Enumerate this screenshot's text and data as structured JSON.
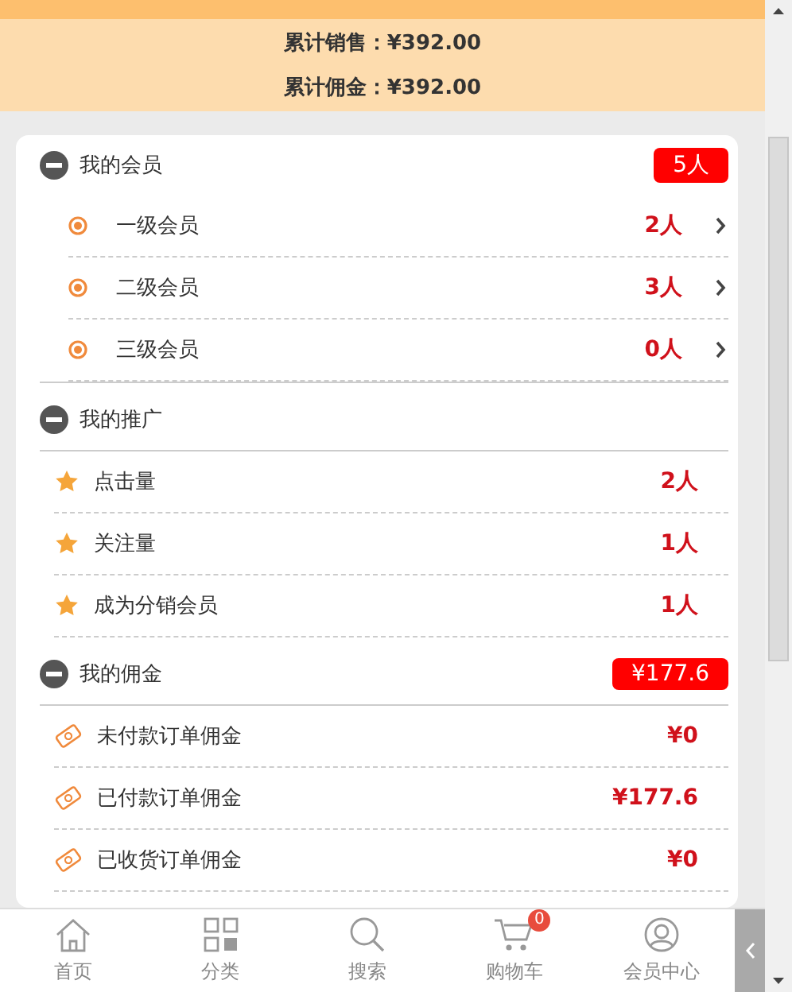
{
  "summary": [
    "累计销售：¥392.00",
    "累计佣金：¥392.00"
  ],
  "sections": [
    {
      "title": "我的会员",
      "kind": "member",
      "expanded": true,
      "badge": "5人",
      "items": [
        {
          "label": "一级会员",
          "value": "2人"
        },
        {
          "label": "二级会员",
          "value": "3人"
        },
        {
          "label": "三级会员",
          "value": "0人"
        }
      ]
    },
    {
      "title": "我的推广",
      "kind": "promo",
      "expanded": true,
      "items": [
        {
          "label": "点击量",
          "value": "2人"
        },
        {
          "label": "关注量",
          "value": "1人"
        },
        {
          "label": "成为分销会员",
          "value": "1人"
        }
      ]
    },
    {
      "title": "我的佣金",
      "kind": "commission",
      "expanded": true,
      "badge": "¥177.6",
      "items": [
        {
          "label": "未付款订单佣金",
          "value": "¥0"
        },
        {
          "label": "已付款订单佣金",
          "value": "¥177.6"
        },
        {
          "label": "已收货订单佣金",
          "value": "¥0"
        }
      ]
    }
  ],
  "nav": [
    {
      "kind": "home",
      "label": "首页"
    },
    {
      "kind": "category",
      "label": "分类"
    },
    {
      "kind": "search",
      "label": "搜索"
    },
    {
      "kind": "cart",
      "label": "购物车",
      "badge": "0"
    },
    {
      "kind": "user",
      "label": "会员中心"
    }
  ]
}
